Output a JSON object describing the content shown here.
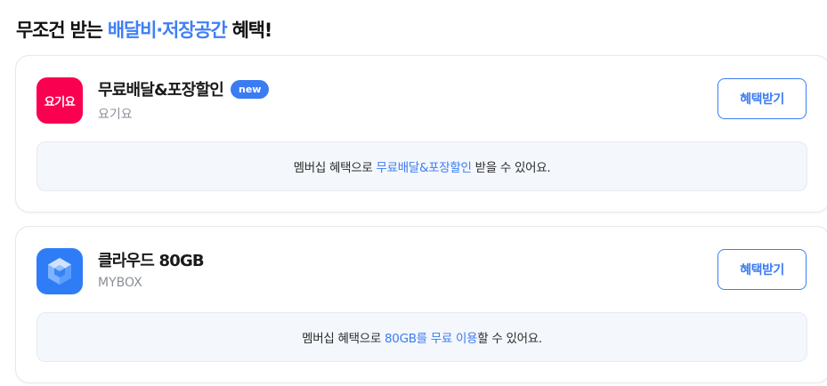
{
  "header": {
    "title_prefix": "무조건 받는 ",
    "title_highlight": "배달비·저장공간",
    "title_suffix": " 혜택!"
  },
  "cards": [
    {
      "icon": {
        "name": "yogiyo-logo",
        "text": "요기요",
        "color": "#fa0050"
      },
      "title": "무료배달&포장할인",
      "badge": "new",
      "subtitle": "요기요",
      "button_label": "혜택받기",
      "info": {
        "prefix": "멤버십 혜택으로 ",
        "highlight": "무료배달&포장할인",
        "suffix": " 받을 수 있어요."
      }
    },
    {
      "icon": {
        "name": "mybox-logo",
        "color": "#2f7df6"
      },
      "title": "클라우드 80GB",
      "subtitle": "MYBOX",
      "button_label": "혜택받기",
      "info": {
        "prefix": "멤버십 혜택으로 ",
        "highlight": "80GB를 무료 이용",
        "suffix": "할 수 있어요."
      }
    }
  ],
  "colors": {
    "accent": "#3b7cf3",
    "title_highlight": "#3f7ff5",
    "info_bg": "#f4f7fc"
  }
}
